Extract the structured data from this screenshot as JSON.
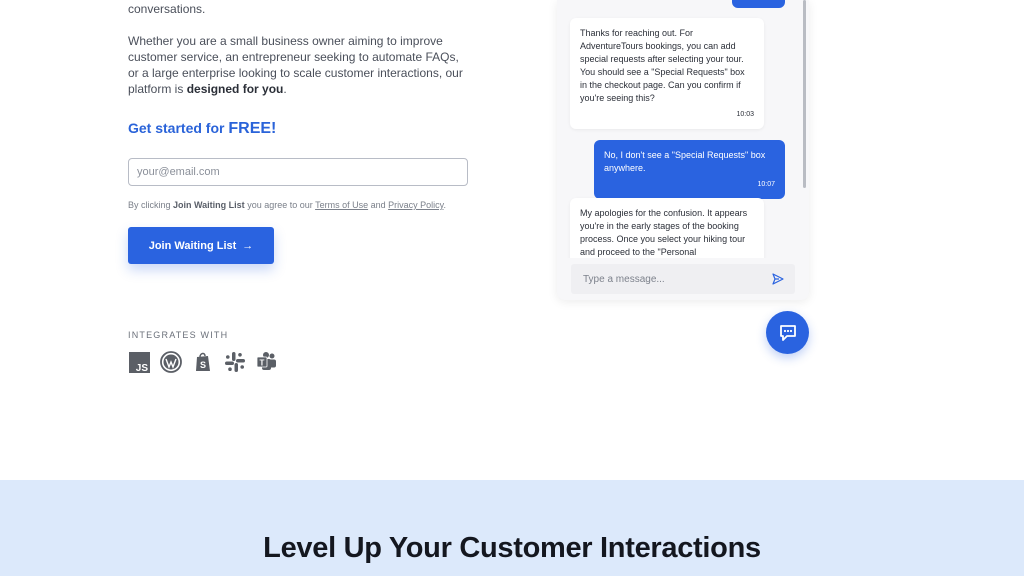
{
  "hero": {
    "intro_tail": "conversations.",
    "para_1": "Whether you are a small business owner aiming to improve customer service, an entrepreneur seeking to automate FAQs, or a large enterprise looking to scale customer interactions, our platform is ",
    "para_bold": "designed for you",
    "para_end": ".",
    "cta_prefix": "Get started for ",
    "cta_free": "FREE!",
    "email_placeholder": "your@email.com",
    "terms_1": "By clicking ",
    "terms_bold": "Join Waiting List",
    "terms_2": " you agree to our ",
    "terms_link": "Terms of Use",
    "terms_3": " and ",
    "privacy_link": "Privacy Policy",
    "terms_4": ".",
    "join_label": "Join Waiting List",
    "join_arrow": "→",
    "integrates_label": "INTEGRATES WITH",
    "integrations": [
      "javascript-icon",
      "wordpress-icon",
      "shopify-icon",
      "slack-icon",
      "teams-icon"
    ]
  },
  "chat": {
    "messages": [
      {
        "from": "bot",
        "text": "Thanks for reaching out. For AdventureTours bookings, you can add special requests after selecting your tour. You should see a \"Special Requests\" box in the checkout page. Can you confirm if you're seeing this?",
        "time": "10:03"
      },
      {
        "from": "user",
        "text": "No, I don't see a \"Special Requests\" box anywhere.",
        "time": "10:07"
      },
      {
        "from": "bot",
        "text": "My apologies for the confusion. It appears you're in the early stages of the booking process. Once you select your hiking tour and proceed to the \"Personal"
      }
    ],
    "input_placeholder": "Type a message..."
  },
  "section": {
    "title": "Level Up Your Customer Interactions"
  },
  "colors": {
    "accent": "#2a63e0",
    "band": "#dce9fb"
  }
}
